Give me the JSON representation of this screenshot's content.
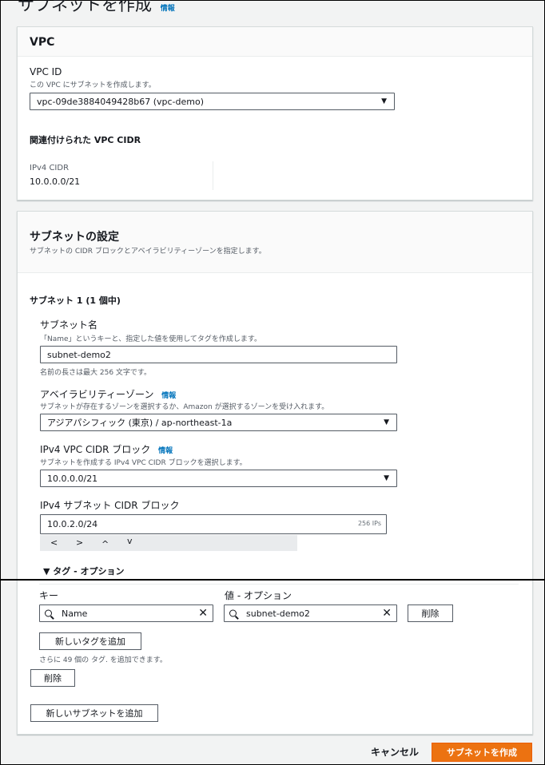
{
  "page": {
    "title": "サブネットを作成",
    "info": "情報"
  },
  "vpc": {
    "heading": "VPC",
    "vpc_id_label": "VPC ID",
    "vpc_id_desc": "この VPC にサブネットを作成します。",
    "vpc_id_value": "vpc-09de3884049428b67 (vpc-demo)",
    "cidr_heading": "関連付けられた VPC CIDR",
    "ipv4_label": "IPv4 CIDR",
    "ipv4_value": "10.0.0.0/21"
  },
  "subnet_settings": {
    "heading": "サブネットの設定",
    "desc": "サブネットの CIDR ブロックとアベイラビリティーゾーンを指定します。",
    "subnet_title": "サブネット 1 (1 個中)",
    "name_label": "サブネット名",
    "name_desc": "「Name」というキーと、指定した値を使用してタグを作成します。",
    "name_value": "subnet-demo2",
    "name_hint": "名前の長さは最大 256 文字です。",
    "az_label": "アベイラビリティーゾーン",
    "az_info": "情報",
    "az_desc": "サブネットが存在するゾーンを選択するか、Amazon が選択するゾーンを受け入れます。",
    "az_value": "アジアパシフィック (東京) / ap-northeast-1a",
    "vpc_cidr_label": "IPv4 VPC CIDR ブロック",
    "vpc_cidr_info": "情報",
    "vpc_cidr_desc": "サブネットを作成する IPv4 VPC CIDR ブロックを選択します。",
    "vpc_cidr_value": "10.0.0.0/21",
    "subnet_cidr_label": "IPv4 サブネット CIDR ブロック",
    "subnet_cidr_value": "10.0.2.0/24",
    "subnet_cidr_ips": "256 IPs",
    "nav_glyphs": [
      "<",
      ">",
      "^",
      "v"
    ],
    "tags_toggle": "▼ タグ - オプション",
    "key_label": "キー",
    "value_label": "値 - オプション",
    "key_value": "Name",
    "tag_value": "subnet-demo2",
    "remove_tag": "削除",
    "add_tag": "新しいタグを追加",
    "tag_limit": "さらに 49 個の タグ. を追加できます。",
    "remove_subnet": "削除",
    "add_subnet": "新しいサブネットを追加"
  },
  "footer": {
    "cancel": "キャンセル",
    "create": "サブネットを作成"
  },
  "colors": {
    "accent": "#ec7211",
    "link": "#0073bb"
  }
}
